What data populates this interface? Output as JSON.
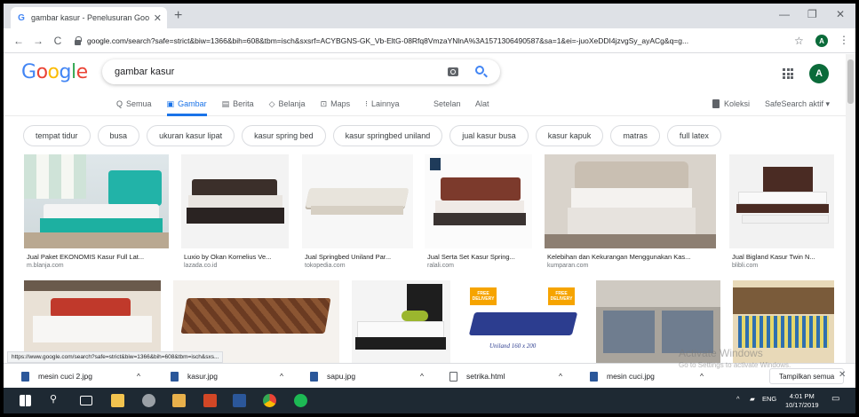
{
  "browser": {
    "tab_title": "gambar kasur - Penelusuran Goo",
    "url": "google.com/search?safe=strict&biw=1366&bih=608&tbm=isch&sxsrf=ACYBGNS-GK_Vb-EltG-08Rfq8VmzaYNlnA%3A1571306490587&sa=1&ei=-juoXeDDI4jzvgSy_ayACg&q=g...",
    "status_url": "https://www.google.com/search?safe=strict&biw=1366&bih=608&tbm=isch&sxs..."
  },
  "google": {
    "logo": [
      "G",
      "o",
      "o",
      "g",
      "l",
      "e"
    ],
    "query": "gambar kasur",
    "avatar_letter": "A",
    "tabs": [
      {
        "icon": "Q",
        "label": "Semua"
      },
      {
        "icon": "▣",
        "label": "Gambar"
      },
      {
        "icon": "▤",
        "label": "Berita"
      },
      {
        "icon": "◇",
        "label": "Belanja"
      },
      {
        "icon": "⊡",
        "label": "Maps"
      },
      {
        "icon": "⁝",
        "label": "Lainnya"
      }
    ],
    "settings": "Setelan",
    "tools": "Alat",
    "collections": "Koleksi",
    "safesearch": "SafeSearch aktif ▾"
  },
  "chips": [
    "tempat tidur",
    "busa",
    "ukuran kasur lipat",
    "kasur spring bed",
    "kasur springbed uniland",
    "jual kasur busa",
    "kasur kapuk",
    "matras",
    "full latex"
  ],
  "results": [
    {
      "title": "Jual Paket EKONOMIS Kasur Full Lat...",
      "source": "m.blanja.com"
    },
    {
      "title": "Luxio by Okan Kornelius Ve...",
      "source": "lazada.co.id"
    },
    {
      "title": "Jual Springbed Uniland Par...",
      "source": "tokopedia.com"
    },
    {
      "title": "Jual Serta Set Kasur Spring...",
      "source": "ralali.com"
    },
    {
      "title": "Kelebihan dan Kekurangan Menggunakan Kas...",
      "source": "kumparan.com"
    },
    {
      "title": "Jual Bigland Kasur Twin N...",
      "source": "blibli.com"
    }
  ],
  "row2_text": {
    "free_delivery_1": "FREE DELIVERY",
    "free_delivery_2": "FREE DELIVERY",
    "uniland": "Uniland 160 x 200"
  },
  "watermark": {
    "line1": "Activate Windows",
    "line2": "Go to Settings to activate Windows."
  },
  "downloads": [
    {
      "name": "mesin cuci 2.jpg"
    },
    {
      "name": "kasur.jpg"
    },
    {
      "name": "sapu.jpg"
    },
    {
      "name": "setrika.html"
    },
    {
      "name": "mesin cuci.jpg"
    }
  ],
  "show_all": "Tampilkan semua",
  "tray": {
    "lang": "ENG",
    "time": "4:01 PM",
    "date": "10/17/2019"
  }
}
